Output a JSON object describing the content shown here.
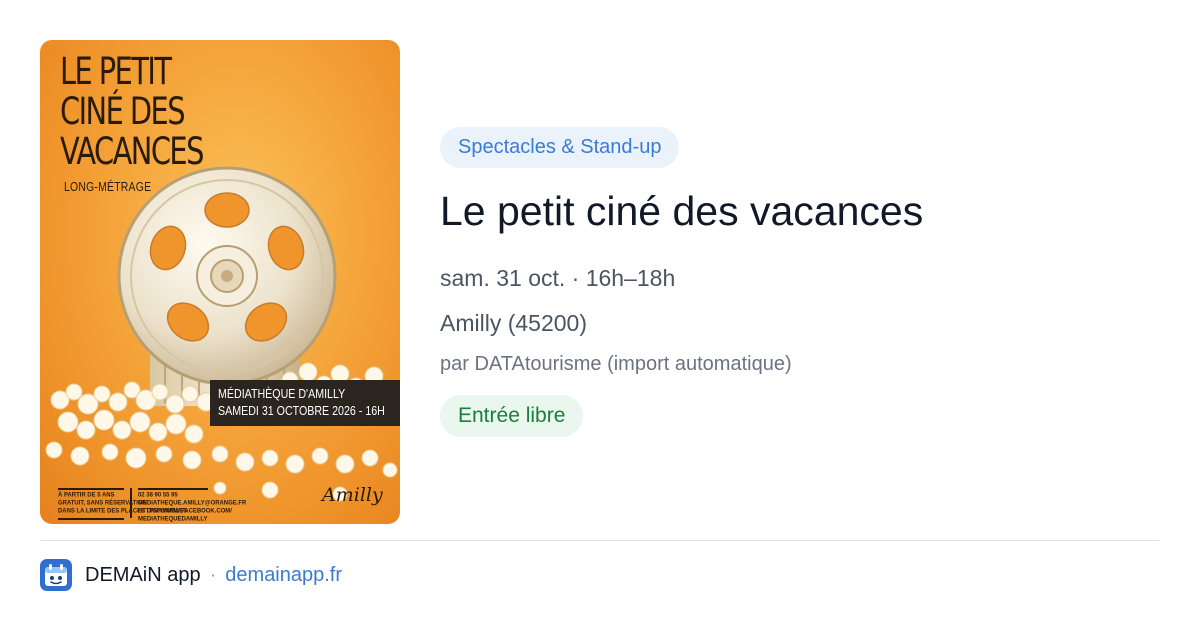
{
  "poster": {
    "title_lines": [
      "LE PETIT",
      "CINÉ DES",
      "VACANCES"
    ],
    "subtitle": "LONG-MÉTRAGE",
    "venue_lines": [
      "MÉDIATHÈQUE D'AMILLY",
      "SAMEDI 31 OCTOBRE 2026 - 16H"
    ],
    "info_left": [
      "À PARTIR DE 5 ANS",
      "GRATUIT, SANS RÉSERVATION",
      "DANS LA LIMITE DES PLACES DISPONIBLES"
    ],
    "info_right": [
      "02 38 90 55 95",
      "MEDIATHEQUE.AMILLY@ORANGE.FR",
      "HTTPS://WWW.FACEBOOK.COM/",
      "MEDIATHEQUEDAMILLY"
    ],
    "signature": "Amilly"
  },
  "event": {
    "category": "Spectacles & Stand-up",
    "title": "Le petit ciné des vacances",
    "when": "sam. 31 oct. · 16h–18h",
    "where": "Amilly (45200)",
    "source": "par DATAtourisme (import automatique)",
    "price": "Entrée libre"
  },
  "footer": {
    "app_name": "DEMAiN app",
    "separator": "·",
    "domain": "demainapp.fr"
  },
  "colors": {
    "accent_blue": "#3a7bd5",
    "category_bg": "#eaf2fc",
    "price_green": "#1c7d3c",
    "price_bg": "#e9f7ee",
    "poster_orange": "#f4a43a"
  },
  "icons": {
    "app": "demain-app-icon",
    "reel": "film-reel-icon"
  }
}
